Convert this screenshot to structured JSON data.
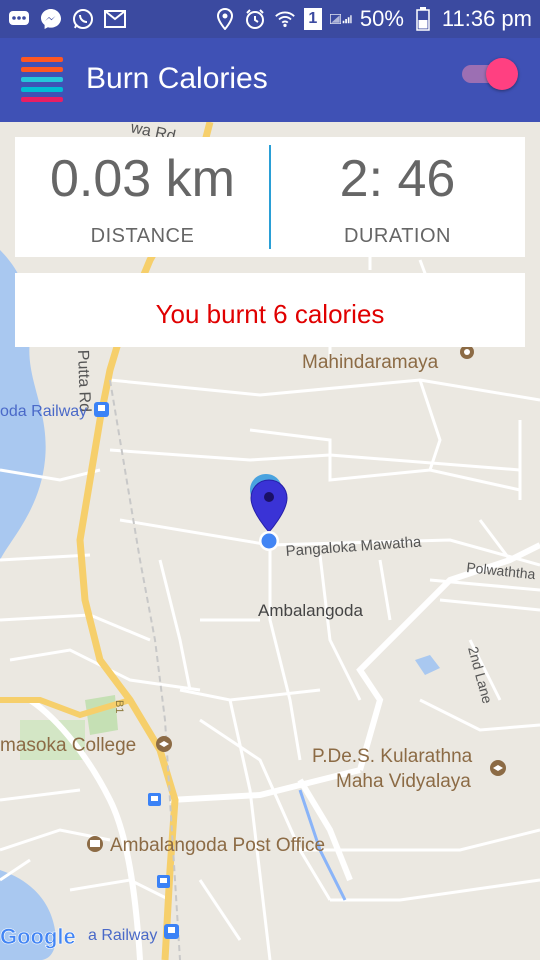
{
  "status_bar": {
    "battery": "50%",
    "time": "11:36 pm",
    "sim": "1",
    "icons": [
      "chat-icon",
      "messenger-icon",
      "whatsapp-icon",
      "gmail-icon",
      "location-icon",
      "alarm-icon",
      "wifi-icon",
      "signal-icon"
    ]
  },
  "app_bar": {
    "title": "Burn Calories",
    "toggle_on": true,
    "accent": "#ff4081"
  },
  "stats": {
    "distance": {
      "value": "0.03 km",
      "label": "DISTANCE"
    },
    "duration": {
      "value": "2: 46",
      "label": "DURATION"
    }
  },
  "calories": {
    "text": "You burnt 6 calories"
  },
  "map": {
    "labels": {
      "road_top": "wa Rd",
      "road_left": "Putta Rd",
      "railway_top": "oda Railway",
      "temple": "Mahindaramaya",
      "street": "Pangaloka Mawatha",
      "street_right": "Polwaththa",
      "town": "Ambalangoda",
      "lane": "2nd Lane",
      "college": "masoka College",
      "school_1": "P.De.S. Kularathna",
      "school_2": "Maha Vidyalaya",
      "post_office": "Ambalangoda Post Office",
      "railway_bottom": "a Railway",
      "route": "B1",
      "logo": "Google"
    }
  },
  "colors": {
    "primary": "#3f51b5",
    "status_bar": "#3b4aa0",
    "calories_text": "#e00000",
    "divider": "#2a9fd6"
  }
}
